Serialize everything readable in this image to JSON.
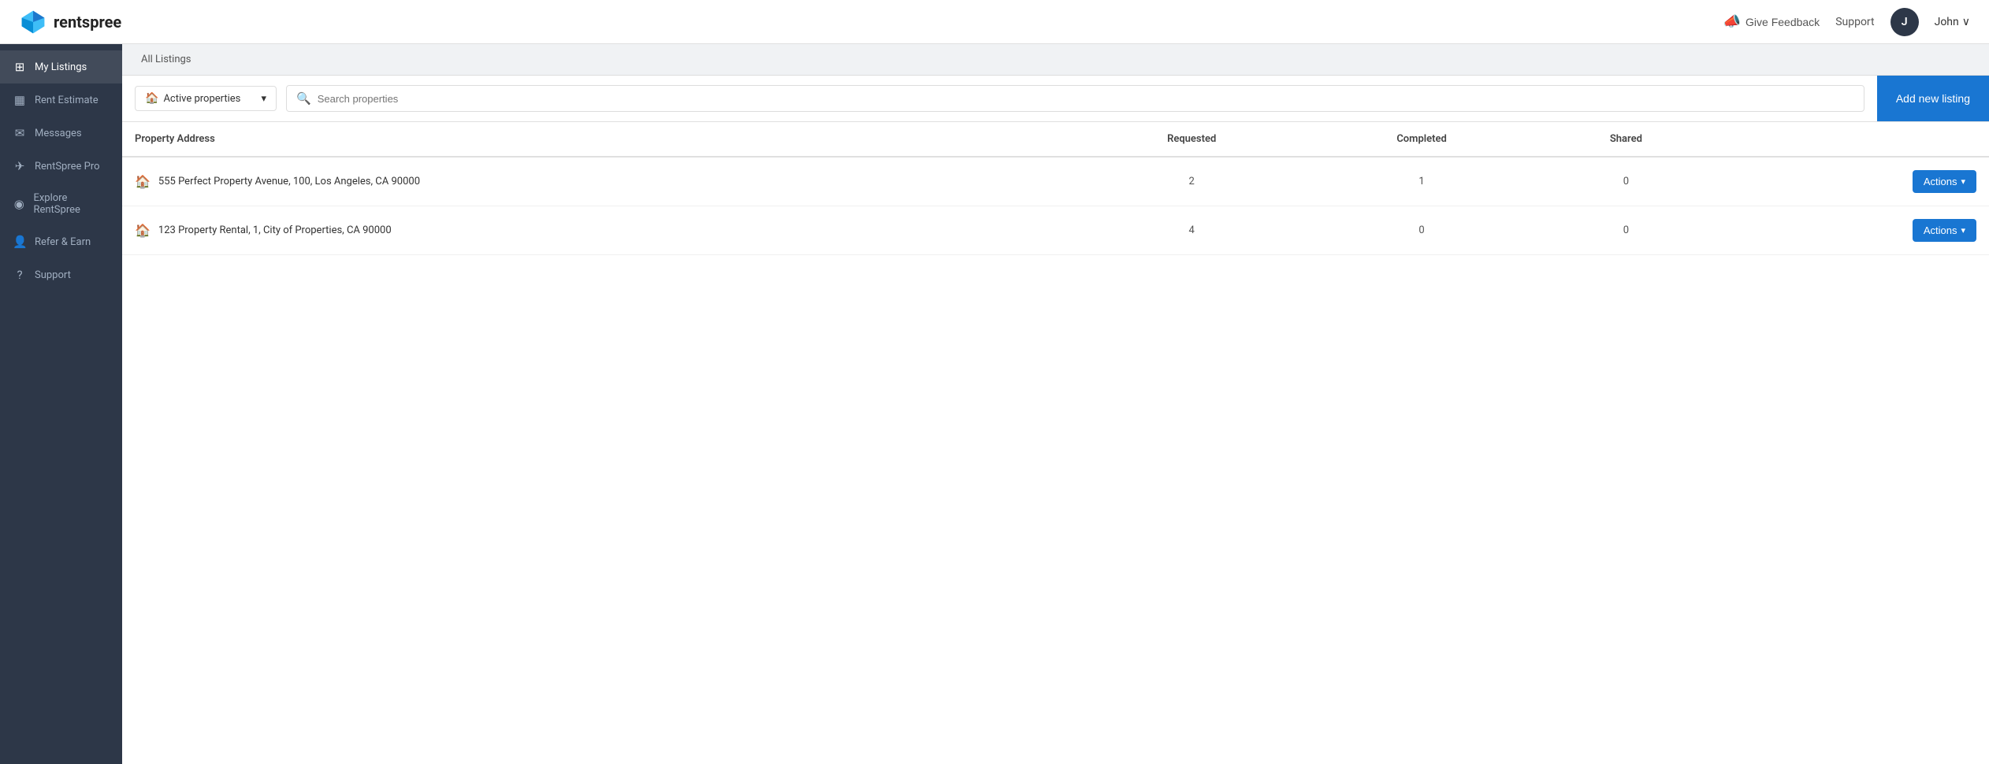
{
  "app": {
    "logo_first": "rent",
    "logo_second": "spree"
  },
  "topnav": {
    "feedback_label": "Give Feedback",
    "support_label": "Support",
    "user_label": "John",
    "user_initial": "J",
    "chevron": "∨"
  },
  "sidebar": {
    "items": [
      {
        "id": "my-listings",
        "label": "My Listings",
        "icon": "⊞",
        "active": true
      },
      {
        "id": "rent-estimate",
        "label": "Rent Estimate",
        "icon": "▦"
      },
      {
        "id": "messages",
        "label": "Messages",
        "icon": "✉"
      },
      {
        "id": "rentspree-pro",
        "label": "RentSpree Pro",
        "icon": "✈"
      },
      {
        "id": "explore",
        "label": "Explore RentSpree",
        "icon": "◉"
      },
      {
        "id": "refer-earn",
        "label": "Refer & Earn",
        "icon": "👤"
      },
      {
        "id": "support",
        "label": "Support",
        "icon": "?"
      }
    ]
  },
  "breadcrumb": "All Listings",
  "toolbar": {
    "filter_label": "Active properties",
    "filter_icon": "🏠",
    "search_placeholder": "Search properties",
    "add_listing_label": "Add new listing"
  },
  "table": {
    "columns": [
      {
        "id": "address",
        "label": "Property Address"
      },
      {
        "id": "requested",
        "label": "Requested"
      },
      {
        "id": "completed",
        "label": "Completed"
      },
      {
        "id": "shared",
        "label": "Shared"
      },
      {
        "id": "actions",
        "label": ""
      }
    ],
    "rows": [
      {
        "id": "row1",
        "address": "555 Perfect Property Avenue, 100, Los Angeles, CA 90000",
        "requested": "2",
        "completed": "1",
        "shared": "0",
        "actions_label": "Actions"
      },
      {
        "id": "row2",
        "address": "123 Property Rental, 1, City of Properties, CA 90000",
        "requested": "4",
        "completed": "0",
        "shared": "0",
        "actions_label": "Actions"
      }
    ]
  }
}
